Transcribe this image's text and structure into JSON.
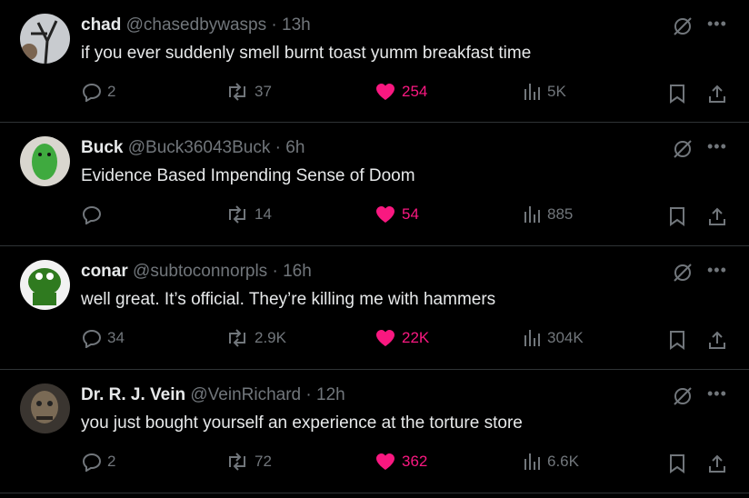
{
  "tweets": [
    {
      "name": "chad",
      "handle": "@chasedbywasps",
      "time": "13h",
      "text": "if you ever suddenly smell burnt toast yumm breakfast time",
      "replies": "2",
      "reposts": "37",
      "likes": "254",
      "views": "5K",
      "avatar_color": "#6b7a80"
    },
    {
      "name": "Buck",
      "handle": "@Buck36043Buck",
      "time": "6h",
      "text": "Evidence Based Impending Sense of Doom",
      "replies": "",
      "reposts": "14",
      "likes": "54",
      "views": "885",
      "avatar_color": "#3faa3f"
    },
    {
      "name": "conar",
      "handle": "@subtoconnorpls",
      "time": "16h",
      "text": "well great. It’s official. They’re killing me with hammers",
      "replies": "34",
      "reposts": "2.9K",
      "likes": "22K",
      "views": "304K",
      "avatar_color": "#2f7a1f"
    },
    {
      "name": "Dr. R. J. Vein",
      "handle": "@VeinRichard",
      "time": "12h",
      "text": "you just bought yourself an experience at the torture store",
      "replies": "2",
      "reposts": "72",
      "likes": "362",
      "views": "6.6K",
      "avatar_color": "#5a4a3a"
    }
  ],
  "separator": "·",
  "colors": {
    "like": "#f91880",
    "muted": "#71767b",
    "text": "#e7e9ea",
    "border": "#2f3336"
  }
}
